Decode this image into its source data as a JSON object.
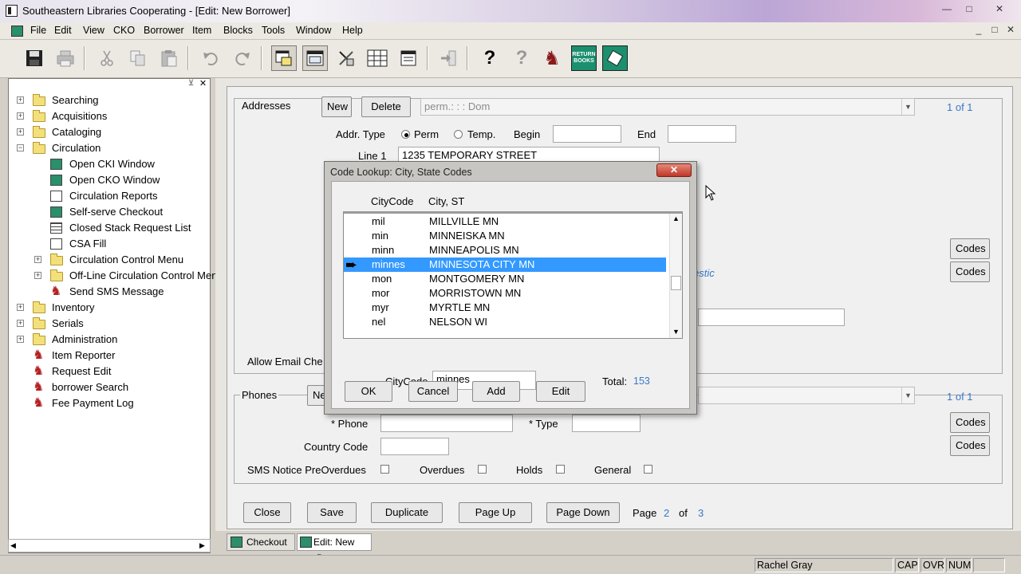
{
  "window": {
    "title": "Southeastern Libraries Cooperating - [Edit: New Borrower]",
    "controls": [
      "—",
      "□",
      "✕"
    ],
    "mdi_controls": [
      "_",
      "□",
      "✕"
    ]
  },
  "menu": [
    "File",
    "Edit",
    "View",
    "CKO",
    "Borrower",
    "Item",
    "Blocks",
    "Tools",
    "Window",
    "Help"
  ],
  "toolbar": {
    "icons": [
      "save-icon",
      "print-icon",
      "cut-icon",
      "copy-icon",
      "paste-icon",
      "undo-icon",
      "redo-icon",
      "window-a-icon",
      "window-b-icon",
      "tools-icon",
      "grid-icon",
      "form-icon",
      "exit-icon",
      "help-icon",
      "context-help-icon",
      "borrower-icon",
      "return-books-icon",
      "checkout-icon"
    ],
    "return_label": "RETURN BOOKS"
  },
  "tree": [
    {
      "label": "Searching",
      "level": 0,
      "type": "folder",
      "exp": "+"
    },
    {
      "label": "Acquisitions",
      "level": 0,
      "type": "folder",
      "exp": "+"
    },
    {
      "label": "Cataloging",
      "level": 0,
      "type": "folder",
      "exp": "+"
    },
    {
      "label": "Circulation",
      "level": 0,
      "type": "folder",
      "exp": "−"
    },
    {
      "label": "Open CKI Window",
      "level": 1,
      "type": "green"
    },
    {
      "label": "Open CKO Window",
      "level": 1,
      "type": "green"
    },
    {
      "label": "Circulation Reports",
      "level": 1,
      "type": "doc"
    },
    {
      "label": "Self-serve Checkout",
      "level": 1,
      "type": "green"
    },
    {
      "label": "Closed Stack Request List",
      "level": 1,
      "type": "grid"
    },
    {
      "label": "CSA Fill",
      "level": 1,
      "type": "doc"
    },
    {
      "label": "Circulation Control Menu",
      "level": 1,
      "type": "folder",
      "exp": "+"
    },
    {
      "label": "Off-Line Circulation Control Men",
      "level": 1,
      "type": "folder",
      "exp": "+"
    },
    {
      "label": "Send SMS Message",
      "level": 1,
      "type": "red"
    },
    {
      "label": "Inventory",
      "level": 0,
      "type": "folder",
      "exp": "+"
    },
    {
      "label": "Serials",
      "level": 0,
      "type": "folder",
      "exp": "+"
    },
    {
      "label": "Administration",
      "level": 0,
      "type": "folder",
      "exp": "+"
    },
    {
      "label": "Item Reporter",
      "level": 0,
      "type": "red"
    },
    {
      "label": "Request Edit",
      "level": 0,
      "type": "red"
    },
    {
      "label": "borrower Search",
      "level": 0,
      "type": "red"
    },
    {
      "label": "Fee Payment Log",
      "level": 0,
      "type": "red"
    }
  ],
  "addresses": {
    "title": "Addresses",
    "new": "New",
    "delete": "Delete",
    "combo": "perm.: : : Dom",
    "counter": "1 of 1",
    "addr_type_label": "Addr. Type",
    "perm": "Perm",
    "temp": "Temp.",
    "begin": "Begin",
    "end": "End",
    "line1_label": "Line 1",
    "line1_value": "1235 TEMPORARY STREET",
    "codes": "Codes",
    "domestic": "estic",
    "allow_email": "Allow Email Che"
  },
  "phones": {
    "title": "Phones",
    "new": "Ne",
    "counter": "1 of 1",
    "phone": "* Phone",
    "type": "* Type",
    "country": "Country Code",
    "codes": "Codes",
    "sms_pre": "SMS Notice PreOverdues",
    "overdues": "Overdues",
    "holds": "Holds",
    "general": "General"
  },
  "footer": {
    "close": "Close",
    "save": "Save",
    "duplicate": "Duplicate",
    "page_up": "Page Up",
    "page_down": "Page Down",
    "page": "Page",
    "page_num": "2",
    "of": "of",
    "page_total": "3"
  },
  "dialog": {
    "title": "Code Lookup: City, State Codes",
    "close": "✕",
    "col1": "CityCode",
    "col2": "City, ST",
    "rows": [
      {
        "code": "mil",
        "city": "MILLVILLE MN"
      },
      {
        "code": "min",
        "city": "MINNEISKA MN"
      },
      {
        "code": "minn",
        "city": "MINNEAPOLIS MN"
      },
      {
        "code": "minnes",
        "city": "MINNESOTA CITY MN",
        "selected": true
      },
      {
        "code": "mon",
        "city": "MONTGOMERY MN"
      },
      {
        "code": "mor",
        "city": "MORRISTOWN MN"
      },
      {
        "code": "myr",
        "city": "MYRTLE MN"
      },
      {
        "code": "nel",
        "city": "NELSON WI"
      }
    ],
    "citycode_label": "CityCode",
    "citycode_value": "minnes",
    "total_label": "Total:",
    "total_value": "153",
    "ok": "OK",
    "cancel": "Cancel",
    "add": "Add",
    "edit": "Edit"
  },
  "tabs": [
    "Checkout",
    "Edit: New Bo..."
  ],
  "status": {
    "user": "Rachel Gray",
    "cap": "CAP",
    "ovr": "OVR",
    "num": "NUM"
  }
}
